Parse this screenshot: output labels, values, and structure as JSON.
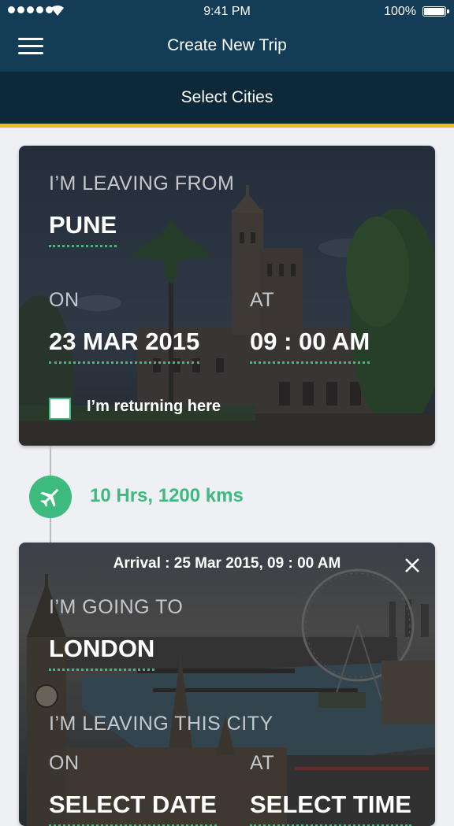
{
  "status_bar": {
    "time": "9:41 PM",
    "battery": "100%"
  },
  "header": {
    "title": "Create New Trip",
    "subtitle": "Select Cities"
  },
  "origin": {
    "leaving_label": "I’M LEAVING FROM",
    "city": "PUNE",
    "on_label": "ON",
    "at_label": "AT",
    "date": "23 MAR 2015",
    "time": "09 : 00 AM",
    "returning_label": "I’m returning here",
    "returning_checked": false
  },
  "transit": {
    "duration": "10 Hrs, 1200 kms",
    "icon": "airplane-icon"
  },
  "destination": {
    "arrival_prefix": "Arrival :",
    "arrival_value": "25 Mar 2015, 09 : 00 AM",
    "going_label": "I’M GOING TO",
    "city": "LONDON",
    "leaving_label": "I’M LEAVING THIS CITY",
    "on_label": "ON",
    "at_label": "AT",
    "date_placeholder": "SELECT DATE",
    "time_placeholder": "SELECT TIME"
  },
  "colors": {
    "header": "#133c57",
    "subheader": "#0d2838",
    "accent": "#f5b623",
    "green": "#3dbb7e",
    "background": "#eef0f4"
  }
}
